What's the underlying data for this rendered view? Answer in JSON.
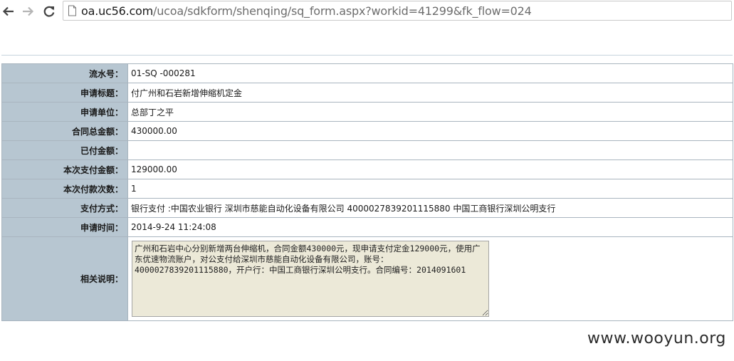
{
  "browser": {
    "url_host": "oa.uc56.com",
    "url_path": "/ucoa/sdkform/shenqing/sq_form.aspx?workid=41299&fk_flow=024"
  },
  "form": {
    "rows": [
      {
        "label": "流水号：",
        "value": "01-SQ -000281"
      },
      {
        "label": "申请标题：",
        "value": "付广州和石岩新增伸缩机定金"
      },
      {
        "label": "申请单位：",
        "value": "总部丁之平"
      },
      {
        "label": "合同总金额：",
        "value": "430000.00"
      },
      {
        "label": "已付金额：",
        "value": ""
      },
      {
        "label": "本次支付金额：",
        "value": "129000.00"
      },
      {
        "label": "本次付款次数：",
        "value": "1"
      },
      {
        "label": "支付方式：",
        "value": "银行支付 :中国农业银行 深圳市慈能自动化设备有限公司 4000027839201115880 中国工商银行深圳公明支行"
      },
      {
        "label": "申请时间：",
        "value": "2014-9-24 11:24:08"
      }
    ],
    "remark_label": "相关说明：",
    "remark_text": "广州和石岩中心分别新增两台伸缩机，合同金额430000元，现申请支付定金129000元，使用广东优速物流账户，对公支付给深圳市慈能自动化设备有限公司，账号：4000027839201115880，开户行：中国工商银行深圳公明支行。合同编号：2014091601"
  },
  "watermark": "www.wooyun.org"
}
